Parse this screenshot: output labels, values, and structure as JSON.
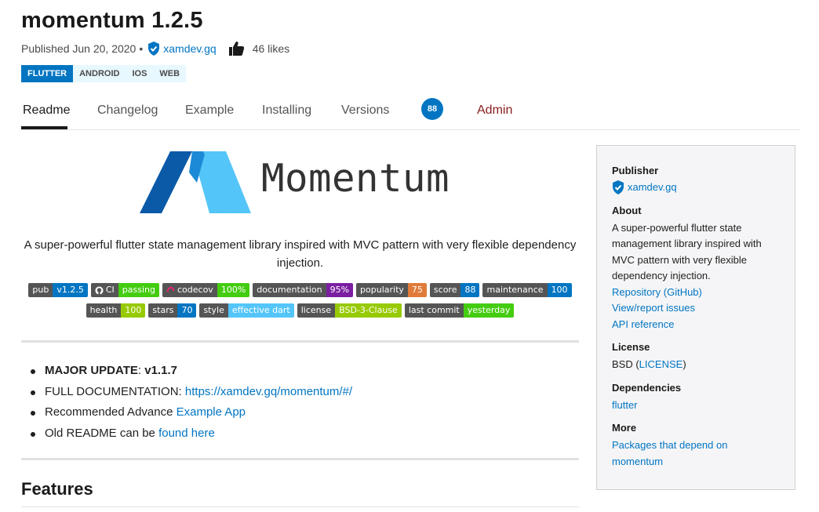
{
  "header": {
    "title": "momentum 1.2.5",
    "published": "Published Jun 20, 2020",
    "separator": "•",
    "publisher": "xamdev.gq",
    "likes": "46 likes"
  },
  "platform_tags": [
    "FLUTTER",
    "ANDROID",
    "IOS",
    "WEB"
  ],
  "tabs": {
    "readme": "Readme",
    "changelog": "Changelog",
    "example": "Example",
    "installing": "Installing",
    "versions": "Versions",
    "score": "88",
    "admin": "Admin"
  },
  "readme": {
    "logo_text": "Momentum",
    "description": "A super-powerful flutter state management library inspired with MVC pattern with very flexible dependency injection.",
    "badges_row1": [
      {
        "label": "pub",
        "value": "v1.2.5",
        "color": "#0175c2"
      },
      {
        "label": "CI",
        "value": "passing",
        "color": "#4c1"
      },
      {
        "label": "codecov",
        "value": "100%",
        "color": "#4c1"
      },
      {
        "label": "documentation",
        "value": "95%",
        "color": "#7b1fa2"
      },
      {
        "label": "popularity",
        "value": "75",
        "color": "#e07b39"
      },
      {
        "label": "score",
        "value": "88",
        "color": "#0175c2"
      },
      {
        "label": "maintenance",
        "value": "100",
        "color": "#0175c2"
      }
    ],
    "badges_row2": [
      {
        "label": "health",
        "value": "100",
        "color": "#97ca00"
      },
      {
        "label": "stars",
        "value": "70",
        "color": "#0175c2"
      },
      {
        "label": "style",
        "value": "effective dart",
        "color": "#54c5f8"
      },
      {
        "label": "license",
        "value": "BSD-3-Clause",
        "color": "#97ca00"
      },
      {
        "label": "last commit",
        "value": "yesterday",
        "color": "#4c1"
      }
    ],
    "bullets": {
      "b1_bold": "MAJOR UPDATE",
      "b1_rest": ": ",
      "b1_version": "v1.1.7",
      "b2_text": "FULL DOCUMENTATION: ",
      "b2_link": "https://xamdev.gq/momentum/#/",
      "b3_text": "Recommended Advance ",
      "b3_link": "Example App",
      "b4_text": "Old README can be ",
      "b4_link": "found here"
    },
    "features_heading": "Features"
  },
  "sidebar": {
    "publisher_heading": "Publisher",
    "publisher": "xamdev.gq",
    "about_heading": "About",
    "about_text": "A super-powerful flutter state management library inspired with MVC pattern with very flexible dependency injection.",
    "repository": "Repository (GitHub)",
    "issues": "View/report issues",
    "api": "API reference",
    "license_heading": "License",
    "license_prefix": "BSD (",
    "license_link": "LICENSE",
    "license_suffix": ")",
    "dependencies_heading": "Dependencies",
    "dependency": "flutter",
    "more_heading": "More",
    "more_link": "Packages that depend on momentum"
  },
  "colors": {
    "accent": "#0175c2",
    "admin": "#8a1c1c",
    "logo_dark": "#0b5aa8",
    "logo_light": "#54c5f8"
  }
}
